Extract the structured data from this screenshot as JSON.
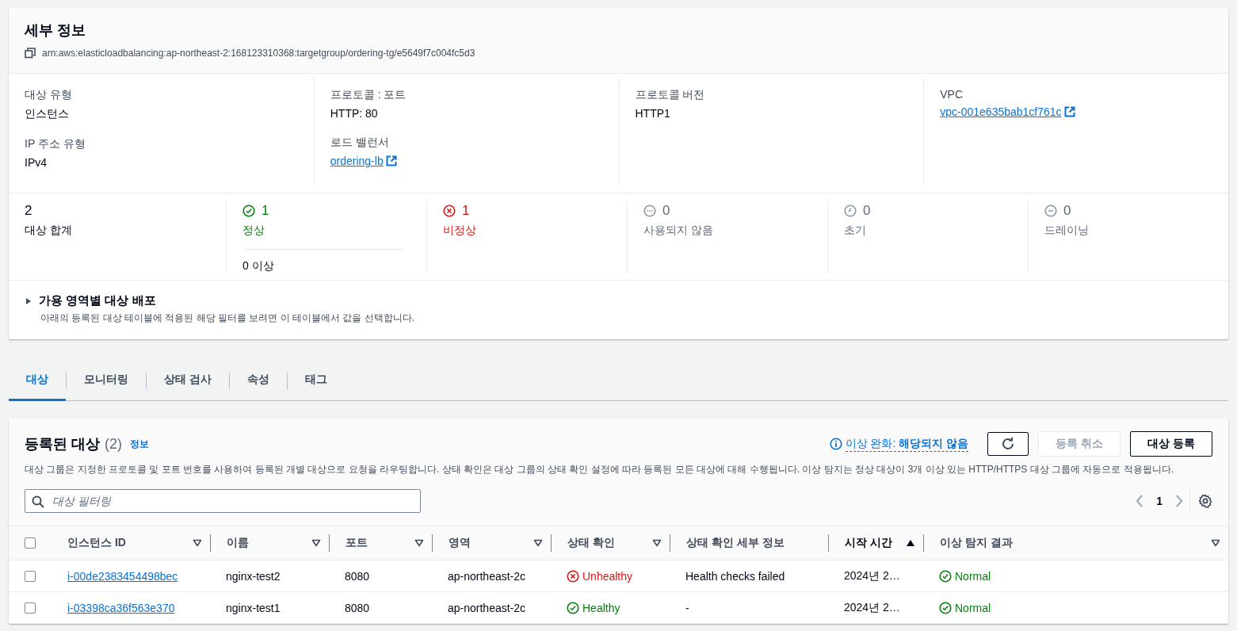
{
  "details": {
    "title": "세부 정보",
    "arn": "arn:aws:elasticloadbalancing:ap-northeast-2:168123310368:targetgroup/ordering-tg/e5649f7c004fc5d3",
    "columns": [
      [
        {
          "label": "대상 유형",
          "value": "인스턴스",
          "kind": "text"
        },
        {
          "label": "IP 주소 유형",
          "value": "IPv4",
          "kind": "text"
        }
      ],
      [
        {
          "label": "프로토콜 : 포트",
          "value": "HTTP: 80",
          "kind": "text"
        },
        {
          "label": "로드 밸런서",
          "value": "ordering-lb",
          "kind": "link"
        }
      ],
      [
        {
          "label": "프로토콜 버전",
          "value": "HTTP1",
          "kind": "text"
        }
      ],
      [
        {
          "label": "VPC",
          "value": "vpc-001e635bab1cf761c",
          "kind": "link"
        }
      ]
    ]
  },
  "counts": [
    {
      "value": "2",
      "label": "대상 합계",
      "kind": "total"
    },
    {
      "value": "1",
      "label": "정상",
      "kind": "healthy",
      "extra": "0 이상"
    },
    {
      "value": "1",
      "label": "비정상",
      "kind": "unhealthy"
    },
    {
      "value": "0",
      "label": "사용되지 않음",
      "kind": "unused"
    },
    {
      "value": "0",
      "label": "초기",
      "kind": "initial"
    },
    {
      "value": "0",
      "label": "드레이닝",
      "kind": "draining"
    }
  ],
  "distribution": {
    "title": "가용 영역별 대상 배포",
    "description": "아래의 등록된 대상 테이블에 적용된 해당 필터를 보려면 이 테이블에서 값을 선택합니다.",
    "expanded": false
  },
  "tabs": [
    {
      "label": "대상",
      "selected": true
    },
    {
      "label": "모니터링",
      "selected": false
    },
    {
      "label": "상태 검사",
      "selected": false
    },
    {
      "label": "속성",
      "selected": false
    },
    {
      "label": "태그",
      "selected": false
    }
  ],
  "targets": {
    "title": "등록된 대상",
    "count": "(2)",
    "info": "정보",
    "description": "대상 그룹은 지정한 프로토콜 및 포트 번호를 사용하여 등록된 개별 대상으로 요청을 라우팅합니다. 상태 확인은 대상 그룹의 상태 확인 설정에 따라 등록된 모든 대상에 대해 수행됩니다. 이상 탐지는 정상 대상이 3개 이상 있는 HTTP/HTTPS 대상 그룹에 자동으로 적용됩니다.",
    "mitigation": {
      "label": "이상 완화:",
      "value": "해당되지 않음"
    },
    "buttons": [
      {
        "label": "등록 취소",
        "disabled": true
      },
      {
        "label": "대상 등록",
        "disabled": false
      }
    ],
    "filter": {
      "placeholder": "대상 필터링"
    },
    "page": "1",
    "select_all_checked": false,
    "columns": [
      {
        "label": "인스턴스 ID",
        "filterable": true,
        "sorted": false
      },
      {
        "label": "이름",
        "filterable": true,
        "sorted": false
      },
      {
        "label": "포트",
        "filterable": true,
        "sorted": false
      },
      {
        "label": "영역",
        "filterable": true,
        "sorted": false
      },
      {
        "label": "상태 확인",
        "filterable": true,
        "sorted": false
      },
      {
        "label": "상태 확인 세부 정보",
        "filterable": false,
        "sorted": false
      },
      {
        "label": "시작 시간",
        "filterable": false,
        "sorted": true
      },
      {
        "label": "이상 탐지 결과",
        "filterable": true,
        "sorted": false
      }
    ],
    "rows": [
      {
        "checked": false,
        "instance_id": "i-00de2383454498bec",
        "name": "nginx-test2",
        "port": "8080",
        "zone": "ap-northeast-2c",
        "health": {
          "label": "Unhealthy",
          "kind": "unhealthy"
        },
        "health_detail": "Health checks failed",
        "start_time": "2024년 2…",
        "anomaly": {
          "label": "Normal",
          "kind": "healthy"
        }
      },
      {
        "checked": false,
        "instance_id": "i-03398ca36f563e370",
        "name": "nginx-test1",
        "port": "8080",
        "zone": "ap-northeast-2c",
        "health": {
          "label": "Healthy",
          "kind": "healthy"
        },
        "health_detail": "-",
        "start_time": "2024년 2…",
        "anomaly": {
          "label": "Normal",
          "kind": "healthy"
        }
      }
    ]
  }
}
